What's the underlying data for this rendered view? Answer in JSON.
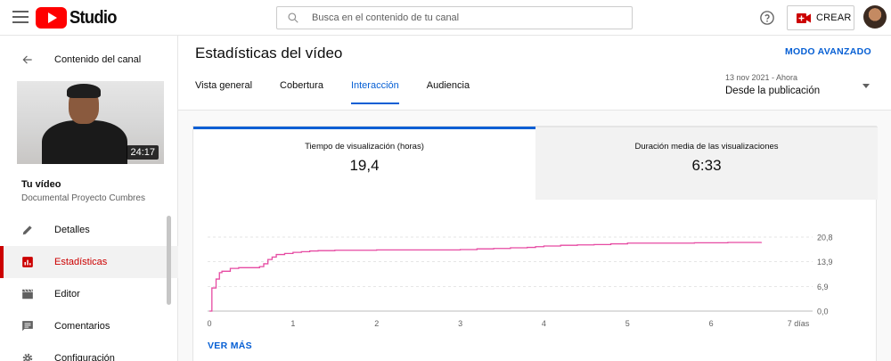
{
  "topbar": {
    "logo_text": "Studio",
    "search_placeholder": "Busca en el contenido de tu canal",
    "create_label": "CREAR"
  },
  "sidebar": {
    "back_label": "Contenido del canal",
    "thumbnail_duration": "24:17",
    "video_title": "Tu vídeo",
    "video_subtitle": "Documental Proyecto Cumbres",
    "items": [
      {
        "label": "Detalles",
        "icon": "pencil-icon",
        "active": false
      },
      {
        "label": "Estadísticas",
        "icon": "analytics-icon",
        "active": true
      },
      {
        "label": "Editor",
        "icon": "clapper-icon",
        "active": false
      },
      {
        "label": "Comentarios",
        "icon": "comment-icon",
        "active": false
      },
      {
        "label": "Configuración",
        "icon": "gear-icon",
        "active": false
      }
    ]
  },
  "header": {
    "title": "Estadísticas del vídeo",
    "advanced_label": "MODO AVANZADO",
    "tabs": [
      {
        "label": "Vista general",
        "active": false
      },
      {
        "label": "Cobertura",
        "active": false
      },
      {
        "label": "Interacción",
        "active": true
      },
      {
        "label": "Audiencia",
        "active": false
      }
    ],
    "range_top": "13 nov 2021 - Ahora",
    "range_main": "Desde la publicación"
  },
  "metrics": [
    {
      "label": "Tiempo de visualización (horas)",
      "value": "19,4",
      "selected": true
    },
    {
      "label": "Duración media de las visualizaciones",
      "value": "6:33",
      "selected": false
    }
  ],
  "more_label": "VER MÁS",
  "colors": {
    "accent": "#065fd4",
    "brand": "#ff0000",
    "line": "#e64aa2"
  },
  "chart_data": {
    "type": "line",
    "x_tick_labels": [
      "0",
      "1",
      "2",
      "3",
      "4",
      "5",
      "6",
      "7 días"
    ],
    "x_ticks": [
      0,
      1,
      2,
      3,
      4,
      5,
      6,
      7
    ],
    "y_tick_labels": [
      "0,0",
      "6,9",
      "13,9",
      "20,8"
    ],
    "y_ticks": [
      0,
      6.9,
      13.9,
      20.8
    ],
    "xlim": [
      0,
      7
    ],
    "ylim": [
      0,
      20.8
    ],
    "grid": true,
    "series": [
      {
        "x": [
          0,
          0.03,
          0.08,
          0.12,
          0.15,
          0.25,
          0.35,
          0.5,
          0.6,
          0.65,
          0.7,
          0.75,
          0.8,
          0.9,
          1.0,
          1.1,
          1.2,
          1.3,
          1.5,
          1.8,
          2.0,
          2.5,
          3.0,
          3.2,
          3.4,
          3.6,
          3.8,
          3.9,
          4.0,
          4.2,
          4.4,
          4.6,
          4.8,
          5.0,
          5.2,
          5.4,
          5.6,
          5.8,
          6.0,
          6.2,
          6.4,
          6.6
        ],
        "y": [
          0,
          6.5,
          9.0,
          10.8,
          11.2,
          12.0,
          12.2,
          12.2,
          12.5,
          13.3,
          14.5,
          15.2,
          15.9,
          16.2,
          16.5,
          16.7,
          16.9,
          17.0,
          17.1,
          17.1,
          17.2,
          17.2,
          17.3,
          17.5,
          17.6,
          17.8,
          17.9,
          18.1,
          18.3,
          18.5,
          18.6,
          18.7,
          18.9,
          19.1,
          19.1,
          19.1,
          19.1,
          19.2,
          19.2,
          19.3,
          19.3,
          19.4
        ]
      }
    ]
  }
}
